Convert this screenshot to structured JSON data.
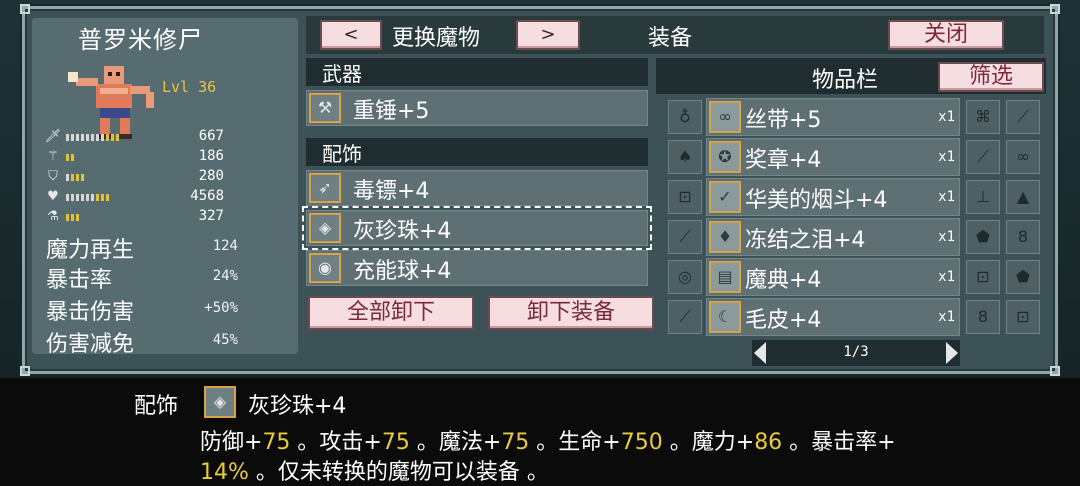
{
  "monster": {
    "name": "普罗米修尸",
    "level": "Lvl 36",
    "stats": [
      {
        "icon": "sword-icon",
        "value": "667",
        "fill": 0.62
      },
      {
        "icon": "wand-icon",
        "value": "186",
        "fill": 0.12
      },
      {
        "icon": "shield-icon",
        "value": "280",
        "fill": 0.22
      },
      {
        "icon": "heart-icon",
        "value": "4568",
        "fill": 0.5
      },
      {
        "icon": "mana-flask-icon",
        "value": "327",
        "fill": 0.16
      }
    ],
    "sub_stats": [
      {
        "label": "魔力再生",
        "value": "124"
      },
      {
        "label": "暴击率",
        "value": "24%"
      },
      {
        "label": "暴击伤害",
        "value": "+50%"
      },
      {
        "label": "伤害减免",
        "value": "45%"
      }
    ]
  },
  "header": {
    "prev_label": "<",
    "title": "更换魔物",
    "next_label": ">",
    "equip_title": "装备",
    "close_label": "关闭"
  },
  "equipment": {
    "weapon_section": "武器",
    "weapon": {
      "icon": "hammer-icon",
      "name": "重锤+5"
    },
    "accessory_section": "配饰",
    "accessories": [
      {
        "icon": "dart-icon",
        "name": "毒镖+4"
      },
      {
        "icon": "pearl-icon",
        "name": "灰珍珠+4"
      },
      {
        "icon": "energy-orb-icon",
        "name": "充能球+4"
      }
    ],
    "unequip_all_label": "全部卸下",
    "unequip_label": "卸下装备"
  },
  "inventory": {
    "title": "物品栏",
    "filter_label": "筛选",
    "rows": [
      {
        "left_icon": "bag-icon",
        "icon": "ribbon-icon",
        "name": "丝带+5",
        "qty": "x1",
        "r1": "gamepad-icon",
        "r2": "feather-icon"
      },
      {
        "left_icon": "bird-icon",
        "icon": "medal-icon",
        "name": "奖章+4",
        "qty": "x1",
        "r1": "feather-icon",
        "r2": "ribbon-icon"
      },
      {
        "left_icon": "lock-icon",
        "icon": "pipe-icon",
        "name": "华美的烟斗+4",
        "qty": "x1",
        "r1": "anvil-icon",
        "r2": "hat-icon"
      },
      {
        "left_icon": "feather-icon",
        "icon": "teardrop-icon",
        "name": "冻结之泪+4",
        "qty": "x1",
        "r1": "shell-icon",
        "r2": "gourd-icon"
      },
      {
        "left_icon": "ring-icon",
        "icon": "book-icon",
        "name": "魔典+4",
        "qty": "x1",
        "r1": "lock-icon",
        "r2": "shell-icon"
      },
      {
        "left_icon": "feather-icon",
        "icon": "fur-icon",
        "name": "毛皮+4",
        "qty": "x1",
        "r1": "gourd-icon",
        "r2": "lock-icon"
      }
    ],
    "page": "1/3"
  },
  "description": {
    "category": "配饰",
    "item_name": "灰珍珠+4",
    "line1": [
      {
        "t": "防御+",
        "hl": false
      },
      {
        "t": "75",
        "hl": true
      },
      {
        "t": " 。攻击+",
        "hl": false
      },
      {
        "t": "75",
        "hl": true
      },
      {
        "t": " 。魔法+",
        "hl": false
      },
      {
        "t": "75",
        "hl": true
      },
      {
        "t": " 。生命+",
        "hl": false
      },
      {
        "t": "750",
        "hl": true
      },
      {
        "t": " 。魔力+",
        "hl": false
      },
      {
        "t": "86",
        "hl": true
      },
      {
        "t": " 。暴击率+",
        "hl": false
      }
    ],
    "line2": [
      {
        "t": "14%",
        "hl": true
      },
      {
        "t": " 。仅未转换的魔物可以装备 。",
        "hl": false
      }
    ]
  },
  "colors": {
    "accent_gold": "#d9a445",
    "highlight_yellow": "#e9cb3b",
    "button_pink": "#f6dde0"
  }
}
